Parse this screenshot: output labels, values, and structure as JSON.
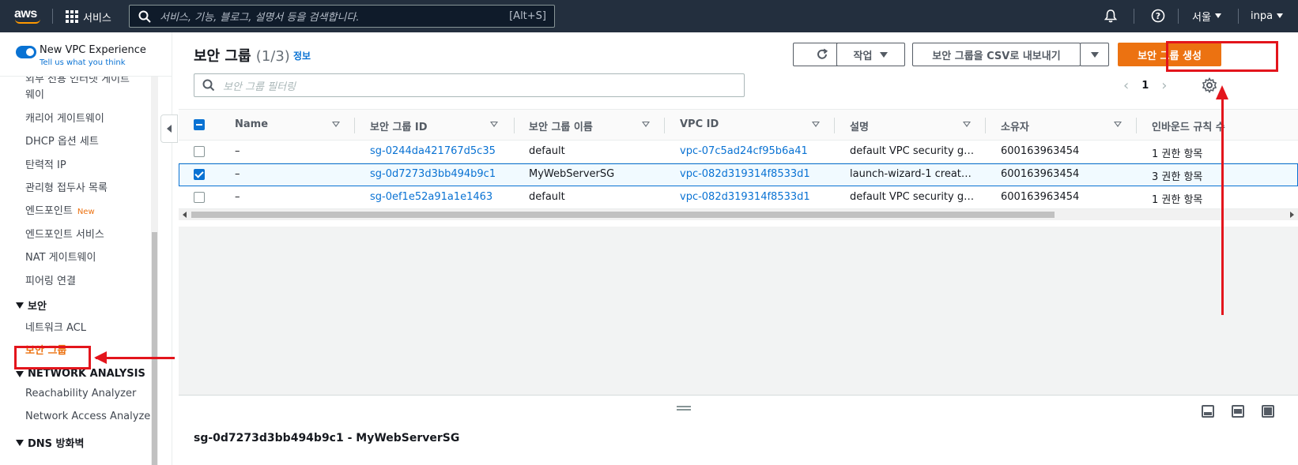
{
  "topnav": {
    "logo": "aws",
    "services_label": "서비스",
    "search_placeholder": "서비스, 기능, 블로그, 설명서 등을 검색합니다.",
    "search_shortcut": "[Alt+S]",
    "region": "서울",
    "user": "inpa",
    "icons": [
      "grid-icon",
      "search-icon",
      "bell-icon",
      "help-icon"
    ]
  },
  "sidebar": {
    "toggle_label": "New VPC Experience",
    "toggle_sub": "Tell us what you think",
    "partial_item_1": "외부 전용 인터넷 게이트",
    "partial_item_2": "웨이",
    "items": [
      {
        "label": "캐리어 게이트웨이"
      },
      {
        "label": "DHCP 옵션 세트"
      },
      {
        "label": "탄력적 IP"
      },
      {
        "label": "관리형 접두사 목록"
      },
      {
        "label": "엔드포인트",
        "badge": "New"
      },
      {
        "label": "엔드포인트 서비스"
      },
      {
        "label": "NAT 게이트웨이"
      },
      {
        "label": "피어링 연결"
      }
    ],
    "security_section": "보안",
    "security_items": [
      {
        "label": "네트워크 ACL"
      },
      {
        "label": "보안 그룹"
      }
    ],
    "network_analysis_section": "NETWORK ANALYSIS",
    "network_analysis_items": [
      {
        "label": "Reachability Analyzer"
      },
      {
        "label": "Network Access Analyzer"
      }
    ],
    "dns_section": "DNS 방화벽"
  },
  "main": {
    "title": "보안 그룹",
    "count": "(1/3)",
    "info_link": "정보",
    "refresh_icon": "refresh-icon",
    "actions_label": "작업",
    "export_label": "보안 그룹을 CSV로 내보내기",
    "create_label": "보안 그룹 생성",
    "filter_placeholder": "보안 그룹 필터링",
    "page_number": "1",
    "columns": [
      "Name",
      "보안 그룹 ID",
      "보안 그룹 이름",
      "VPC ID",
      "설명",
      "소유자",
      "인바운드 규칙 수"
    ],
    "rows": [
      {
        "selected": false,
        "name": "–",
        "sg_id": "sg-0244da421767d5c35",
        "sg_name": "default",
        "vpc_id": "vpc-07c5ad24cf95b6a41",
        "desc": "default VPC security gr…",
        "owner": "600163963454",
        "inbound": "1 권한 항목"
      },
      {
        "selected": true,
        "name": "–",
        "sg_id": "sg-0d7273d3bb494b9c1",
        "sg_name": "MyWebServerSG",
        "vpc_id": "vpc-082d319314f8533d1",
        "desc": "launch-wizard-1 create…",
        "owner": "600163963454",
        "inbound": "3 권한 항목"
      },
      {
        "selected": false,
        "name": "–",
        "sg_id": "sg-0ef1e52a91a1e1463",
        "sg_name": "default",
        "vpc_id": "vpc-082d319314f8533d1",
        "desc": "default VPC security gr…",
        "owner": "600163963454",
        "inbound": "1 권한 항목"
      }
    ]
  },
  "split_panel": {
    "title": "sg-0d7273d3bb494b9c1 - MyWebServerSG"
  },
  "colors": {
    "nav_bg": "#232f3e",
    "primary": "#ec7211",
    "link": "#0972d3",
    "annotation": "#e3151c"
  }
}
